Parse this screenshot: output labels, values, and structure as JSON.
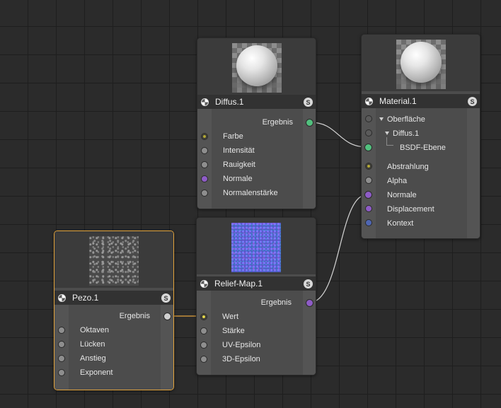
{
  "colors": {
    "green": "#52c07e",
    "yellow": "#b3a834",
    "grey": "#8e8e8e",
    "purple": "#8e5cc6",
    "blue": "#4f66b2",
    "selected_border": "#e3a43c",
    "wire": "#d4d4d4"
  },
  "diffus": {
    "title": "Diffus.1",
    "solo": "S",
    "output": "Ergebnis",
    "inputs": [
      "Farbe",
      "Intensität",
      "Rauigkeit",
      "Normale",
      "Normalenstärke"
    ]
  },
  "material": {
    "title": "Material.1",
    "solo": "S",
    "tree": [
      "Oberfläche",
      "Diffus.1",
      "BSDF-Ebene"
    ],
    "inputs": [
      "Abstrahlung",
      "Alpha",
      "Normale",
      "Displacement",
      "Kontext"
    ]
  },
  "pezo": {
    "title": "Pezo.1",
    "solo": "S",
    "output": "Ergebnis",
    "inputs": [
      "Oktaven",
      "Lücken",
      "Anstieg",
      "Exponent"
    ]
  },
  "relief": {
    "title": "Relief-Map.1",
    "solo": "S",
    "output": "Ergebnis",
    "inputs": [
      "Wert",
      "Stärke",
      "UV-Epsilon",
      "3D-Epsilon"
    ]
  }
}
